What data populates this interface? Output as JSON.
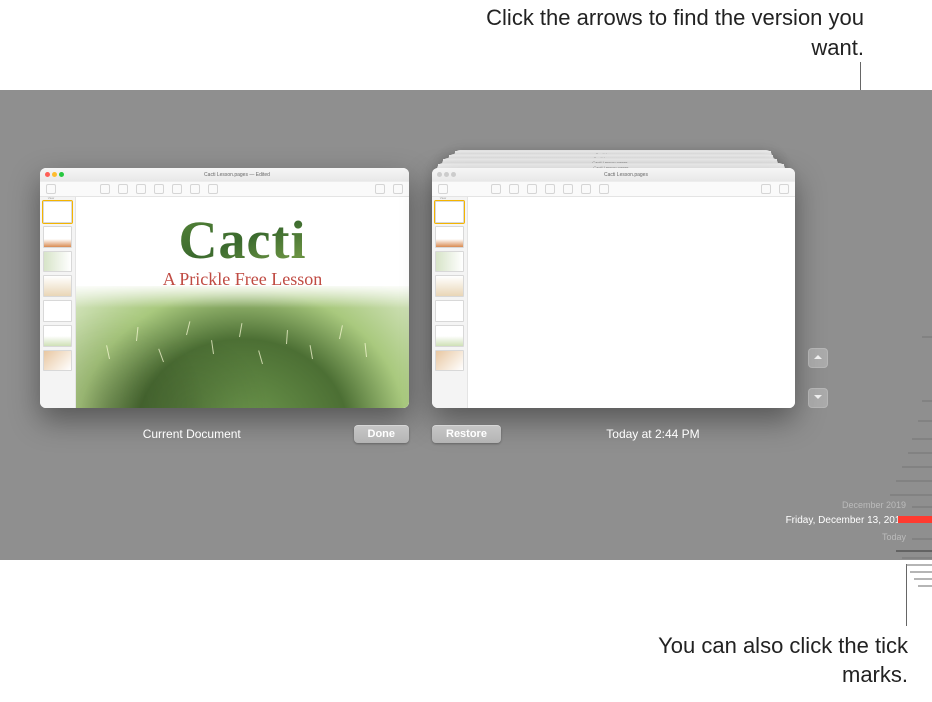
{
  "callouts": {
    "top": "Click the arrows to find the version you want.",
    "bottom": "You can also click the tick marks."
  },
  "left_window": {
    "title": "Cacti Lesson.pages",
    "status": "Edited",
    "toolbar": [
      "View",
      "Insert",
      "Table",
      "Chart",
      "Text",
      "Shape",
      "Media",
      "Comment",
      "Format",
      "Document"
    ],
    "label": "Current Document",
    "button": "Done",
    "content": {
      "headline": "Cacti",
      "subhead": "A Prickle Free Lesson"
    }
  },
  "right_window": {
    "title": "Cacti Lesson.pages",
    "ghost_title": "Cacti Lesson.pages",
    "toolbar": [
      "View",
      "Insert",
      "Table",
      "Chart",
      "Text",
      "Shape",
      "Media",
      "Comment",
      "Format",
      "Document"
    ],
    "label": "Today at 2:44 PM",
    "button": "Restore"
  },
  "nav": {
    "up": "previous-version",
    "down": "next-version"
  },
  "timeline": {
    "labels": {
      "month": "December 2019",
      "selected": "Friday, December 13, 2019",
      "today": "Today"
    }
  }
}
